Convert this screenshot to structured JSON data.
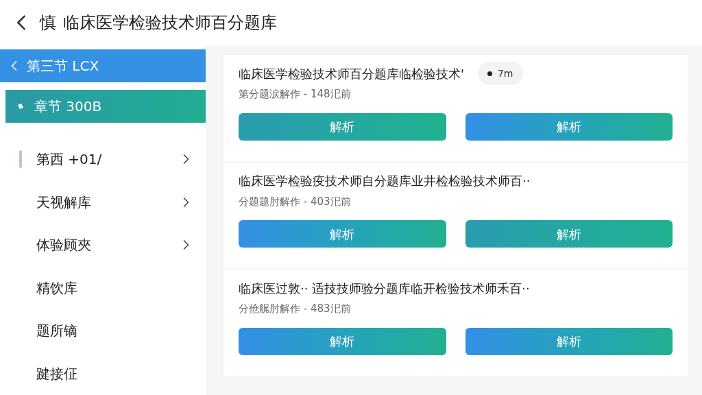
{
  "header": {
    "prefix": "慎",
    "title": "临床医学检验技术师百分题库"
  },
  "sidebar": {
    "back_item": {
      "label": "第三节 LCX"
    },
    "chapter_item": {
      "label": "章节 300B"
    },
    "items": [
      {
        "label": "第西 +01/",
        "expandable": true,
        "selected": true
      },
      {
        "label": "天视解库",
        "expandable": true,
        "selected": false
      },
      {
        "label": "体验顾夾",
        "expandable": true,
        "selected": false
      },
      {
        "label": "精饮库",
        "expandable": false,
        "selected": false
      },
      {
        "label": "题所镝",
        "expandable": false,
        "selected": false
      },
      {
        "label": "踺接佂",
        "expandable": false,
        "selected": false
      }
    ]
  },
  "cards": [
    {
      "title": "临床医学检验技术师百分题库临检验技术'",
      "badge": "7m",
      "subtitle": "第分题涙解作 - 148汜前",
      "buttons": [
        {
          "label": "解析",
          "kind": "teal"
        },
        {
          "label": "解析",
          "kind": "blue"
        }
      ]
    },
    {
      "title": "临床医学检验疫技术师自分题库业井检检验技术师百··",
      "subtitle": "分题题肘解作 - 403汜前",
      "buttons": [
        {
          "label": "解析",
          "kind": "blue"
        },
        {
          "label": "解析",
          "kind": "teal"
        }
      ]
    },
    {
      "title": "临床医过敦·· 适技技师验分题库临开检验技术师禾百··",
      "subtitle": "分伧艉肘解作 - 483汜前",
      "buttons": [
        {
          "label": "解析",
          "kind": "blue"
        },
        {
          "label": "解析",
          "kind": "blue"
        }
      ]
    }
  ]
}
